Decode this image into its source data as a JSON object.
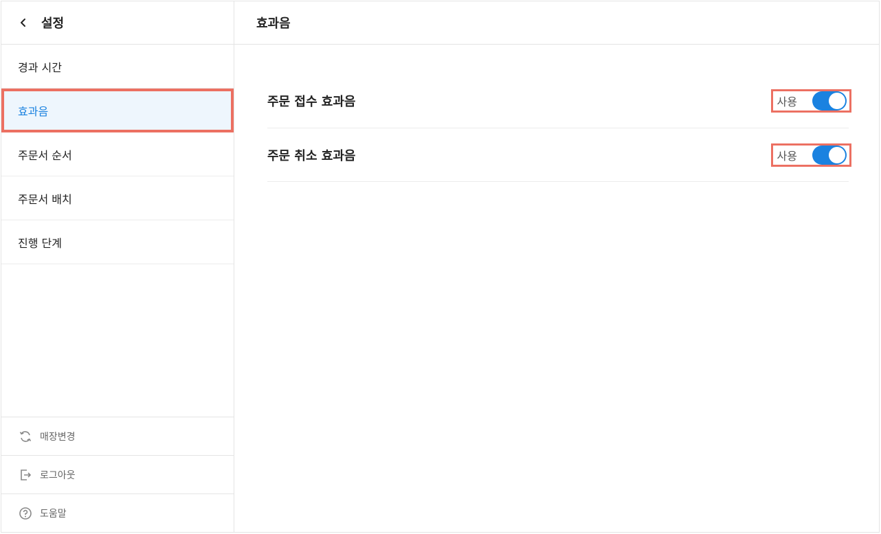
{
  "sidebar": {
    "title": "설정",
    "items": [
      {
        "label": "경과 시간",
        "active": false
      },
      {
        "label": "효과음",
        "active": true
      },
      {
        "label": "주문서 순서",
        "active": false
      },
      {
        "label": "주문서 배치",
        "active": false
      },
      {
        "label": "진행 단계",
        "active": false
      }
    ],
    "bottom": [
      {
        "label": "매장변경",
        "icon": "refresh-icon"
      },
      {
        "label": "로그아웃",
        "icon": "logout-icon"
      },
      {
        "label": "도움말",
        "icon": "help-icon"
      }
    ]
  },
  "main": {
    "title": "효과음",
    "settings": [
      {
        "label": "주문 접수 효과음",
        "toggle_label": "사용",
        "enabled": true
      },
      {
        "label": "주문 취소 효과음",
        "toggle_label": "사용",
        "enabled": true
      }
    ]
  },
  "colors": {
    "accent": "#1a82e0",
    "highlight_border": "#ec7062",
    "active_bg": "#eef6fd"
  }
}
